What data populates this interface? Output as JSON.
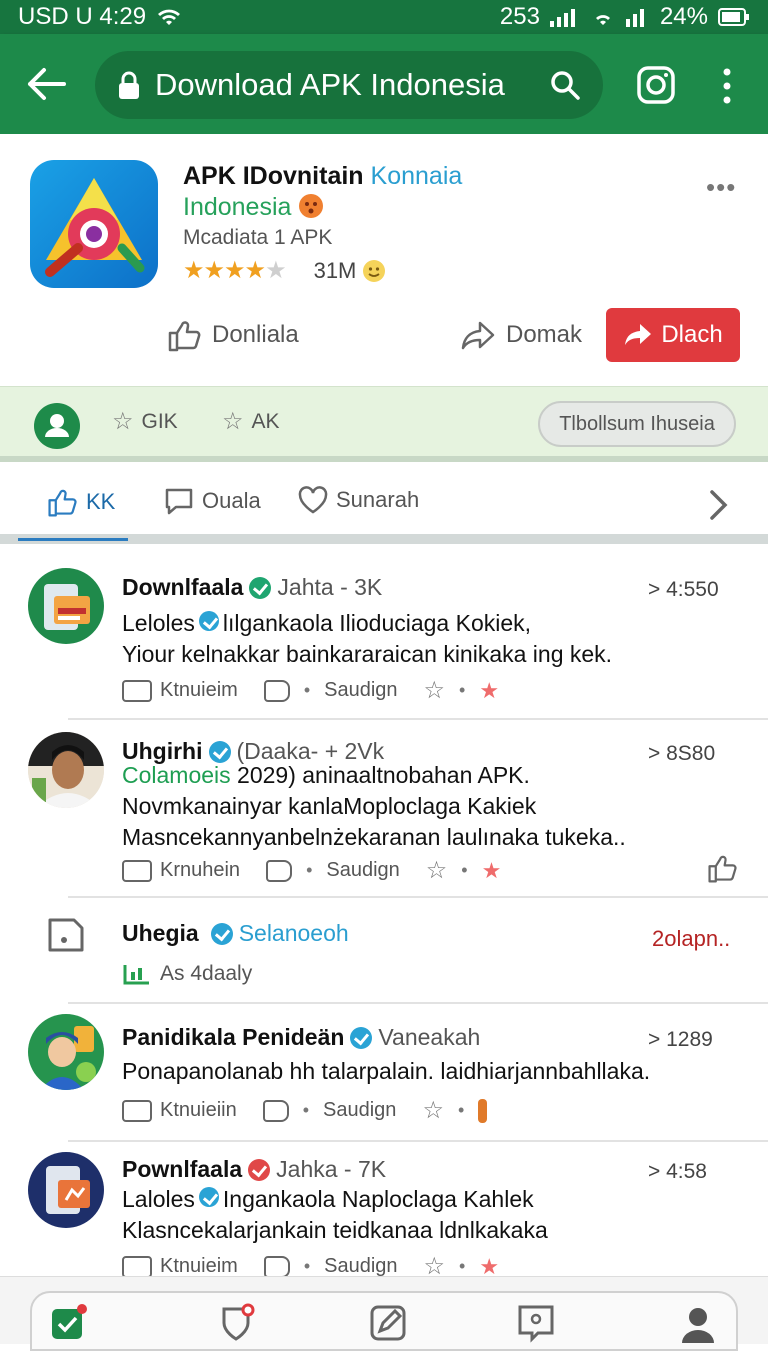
{
  "status_bar": {
    "left": "USD U 4:29",
    "right_time": "253",
    "battery": "24%"
  },
  "app_bar": {
    "url_title": "Download APK Indonesia"
  },
  "app": {
    "title_main": "APK IDovnitain",
    "title_accent": "Konnaia",
    "subtitle": "Indonesia",
    "meta": "Mcadiata 1 APK",
    "rating_value": 4,
    "rating_max": 5,
    "downloads": "31M",
    "btn_like": "Donliala",
    "btn_share": "Domak",
    "btn_primary": "Dlach"
  },
  "action_band": {
    "chip1": "GIK",
    "chip2": "AK",
    "pill": "Tlbollsum Ihuseia"
  },
  "tabs": [
    {
      "label": "KK"
    },
    {
      "label": "Ouala"
    },
    {
      "label": "Sunarah"
    }
  ],
  "feed": [
    {
      "name": "Downlfaala",
      "meta": "Jahta - 3K",
      "count": "> 4:550",
      "lines": [
        "Leloles",
        "lılgankaola Ilioduciaga Kokiek,",
        "Yiour kelnakkar bainkararaican kinikaka ing kek."
      ],
      "action1": "Ktnuieim",
      "action2": "Saudign"
    },
    {
      "name": "Uhgirhi",
      "meta": "(Daaka- + 2Vk",
      "count": "> 8S80",
      "lines": [
        "Colamoeis 2029) aninaaltnobahan APK.",
        "Novmkanainyar kanlaMoploclaga Kakiek",
        "Masncekannyanbelnżekaranan laulınaka tukeka.."
      ],
      "green_prefix": "Colamoeis",
      "line1_rest": "2029) aninaaltnobahan APK.",
      "action1": "Krnuhein",
      "action2": "Saudign"
    },
    {
      "name": "Uhegia",
      "meta": "Selanoeoh",
      "right_text": "2olapn..",
      "sub": "As 4daaly"
    },
    {
      "name": "Panidikala Penideän",
      "meta": "Vaneakah",
      "count": "> 1289",
      "lines": [
        "Ponapanolanab hh talarpalain. laidhiarjannbahllaka."
      ],
      "action1": "Ktnuieiin",
      "action2": "Saudign"
    },
    {
      "name": "Pownlfaala",
      "meta": "Jahka - 7K",
      "count": "> 4:58",
      "lines": [
        "Laloles",
        "Ingankaola Naploclaga Kahlek",
        "Klasncekalarjankain teidkanaa ldnlkakaka"
      ],
      "action1": "Ktnuieim",
      "action2": "Saudign"
    }
  ],
  "colors": {
    "appbar": "#1d8a4a",
    "primary_button": "#e03a3e",
    "band": "#e6f3df",
    "link": "#2a9ed0"
  }
}
